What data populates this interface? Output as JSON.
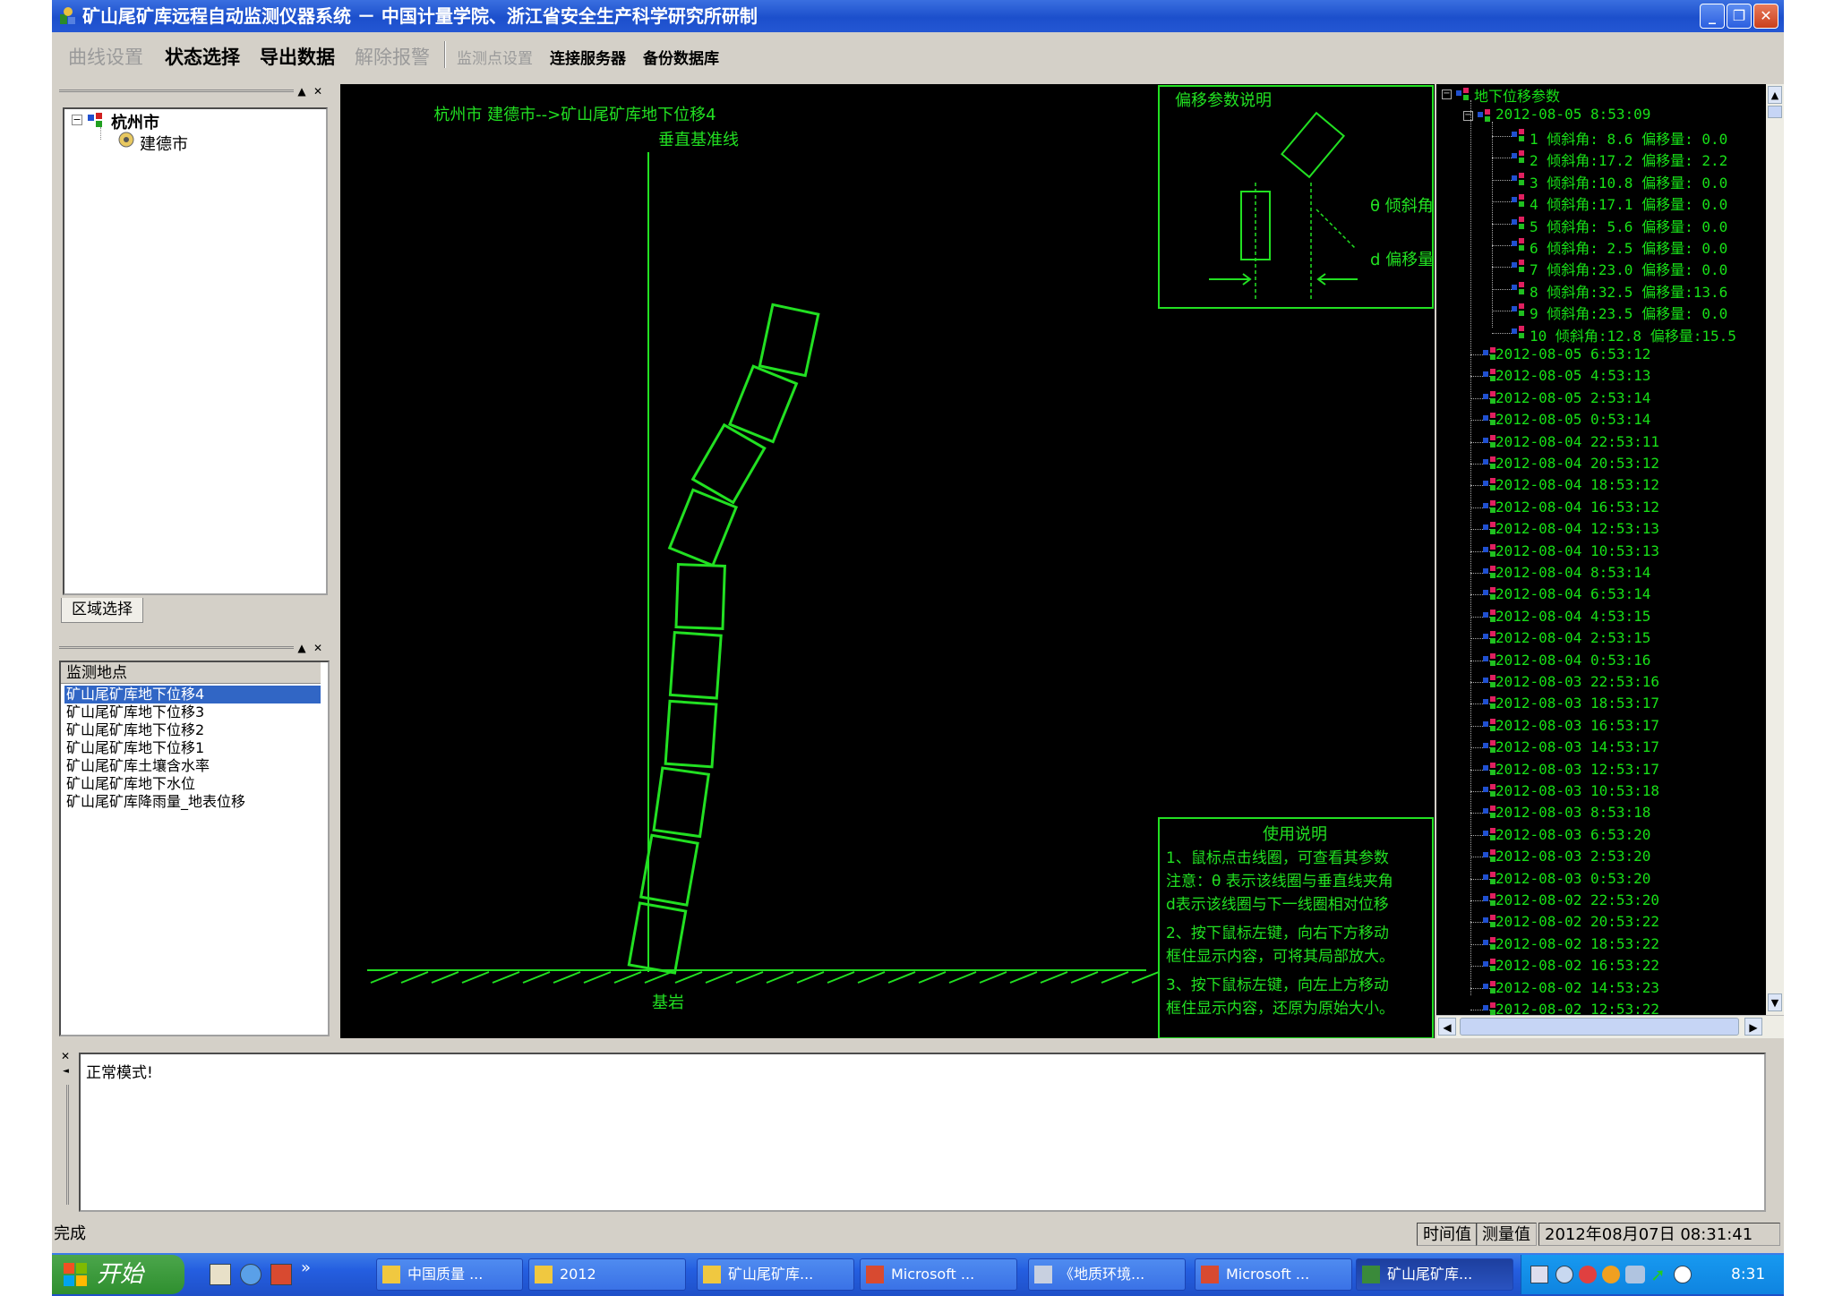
{
  "window": {
    "title": "矿山尾矿库远程自动监测仪器系统 － 中国计量学院、浙江省安全生产科学研究所研制",
    "min": "_",
    "max": "❐",
    "close": "✕"
  },
  "menu": {
    "curve_settings": "曲线设置",
    "status_select": "状态选择",
    "export_data": "导出数据",
    "clear_alarm": "解除报警",
    "monitor_point_settings": "监测点设置",
    "connect_server": "连接服务器",
    "backup_db": "备份数据库"
  },
  "region_tree": {
    "root": "杭州市",
    "child": "建德市",
    "tab_label": "区域选择"
  },
  "monitor_list": {
    "header": "监测地点",
    "items": [
      "矿山尾矿库地下位移4",
      "矿山尾矿库地下位移3",
      "矿山尾矿库地下位移2",
      "矿山尾矿库地下位移1",
      "矿山尾矿库土壤含水率",
      "矿山尾矿库地下水位",
      "矿山尾矿库降雨量_地表位移"
    ],
    "selected_index": 0
  },
  "canvas": {
    "location_title": "杭州市  建德市-->矿山尾矿库地下位移4",
    "baseline_label": "垂直基准线",
    "bedrock_label": "基岩",
    "legend_title": "偏移参数说明",
    "legend_angle": "θ 倾斜角",
    "legend_offset": "d 偏移量",
    "usage_title": "使用说明",
    "usage_lines": [
      "1、鼠标点击线圈，可查看其参数",
      "注意：θ 表示该线圈与垂直线夹角",
      "d表示该线圈与下一线圈相对位移",
      "2、按下鼠标左键，向右下方移动",
      "框住显示内容，可将其局部放大。",
      "3、按下鼠标左键，向左上方移动",
      "框住显示内容，还原为原始大小。"
    ],
    "color": "#22e022"
  },
  "param_tree": {
    "root": "地下位移参数",
    "expanded_time": "2012-08-05 8:53:09",
    "coils": [
      "1 倾斜角: 8.6   偏移量: 0.0",
      "2 倾斜角:17.2   偏移量: 2.2",
      "3 倾斜角:10.8   偏移量: 0.0",
      "4 倾斜角:17.1   偏移量: 0.0",
      "5 倾斜角: 5.6   偏移量: 0.0",
      "6 倾斜角: 2.5   偏移量: 0.0",
      "7 倾斜角:23.0   偏移量: 0.0",
      "8 倾斜角:32.5   偏移量:13.6",
      "9 倾斜角:23.5   偏移量: 0.0",
      "10 倾斜角:12.8   偏移量:15.5"
    ],
    "times": [
      "2012-08-05 6:53:12",
      "2012-08-05 4:53:13",
      "2012-08-05 2:53:14",
      "2012-08-05 0:53:14",
      "2012-08-04 22:53:11",
      "2012-08-04 20:53:12",
      "2012-08-04 18:53:12",
      "2012-08-04 16:53:12",
      "2012-08-04 12:53:13",
      "2012-08-04 10:53:13",
      "2012-08-04 8:53:14",
      "2012-08-04 6:53:14",
      "2012-08-04 4:53:15",
      "2012-08-04 2:53:15",
      "2012-08-04 0:53:16",
      "2012-08-03 22:53:16",
      "2012-08-03 18:53:17",
      "2012-08-03 16:53:17",
      "2012-08-03 14:53:17",
      "2012-08-03 12:53:17",
      "2012-08-03 10:53:18",
      "2012-08-03 8:53:18",
      "2012-08-03 6:53:20",
      "2012-08-03 2:53:20",
      "2012-08-03 0:53:20",
      "2012-08-02 22:53:20",
      "2012-08-02 20:53:22",
      "2012-08-02 18:53:22",
      "2012-08-02 16:53:22",
      "2012-08-02 14:53:23",
      "2012-08-02 12:53:22"
    ]
  },
  "log": {
    "text": "正常模式!"
  },
  "status": {
    "left": "完成",
    "time_value": "时间值",
    "measured_value": "测量值",
    "datetime": "2012年08月07日   08:31:41"
  },
  "taskbar": {
    "start": "开始",
    "items": [
      "中国质量 ...",
      "2012",
      "矿山尾矿库...",
      "Microsoft ...",
      "《地质环境...",
      "Microsoft ...",
      "矿山尾矿库..."
    ],
    "clock": "8:31"
  }
}
